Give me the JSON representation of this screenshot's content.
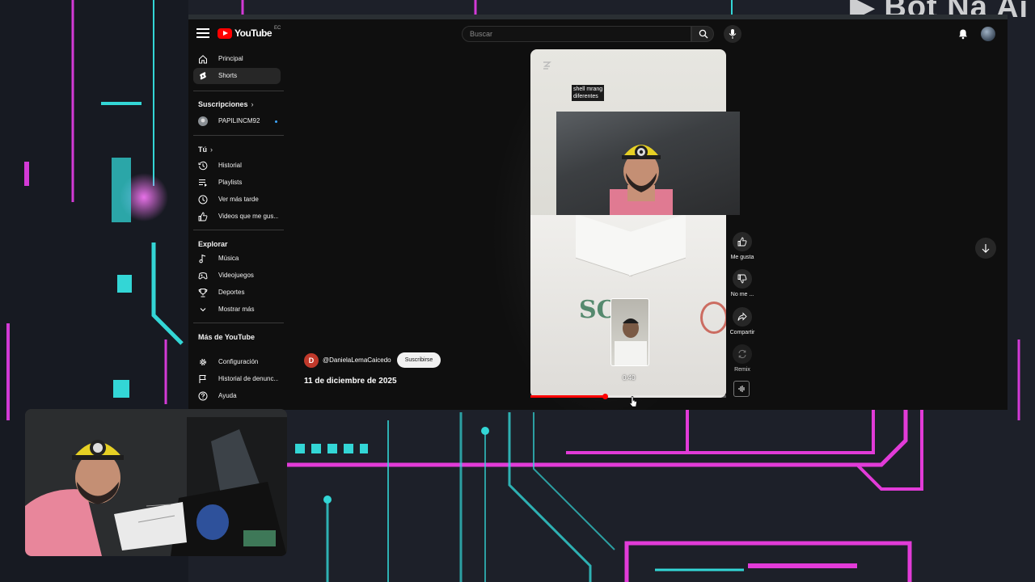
{
  "overlay": {
    "brand_text": "Bot Na Ai"
  },
  "youtube": {
    "logo_text": "YouTube",
    "country_code": "EC",
    "search": {
      "placeholder": "Buscar"
    },
    "sidebar": {
      "main": [
        {
          "label": "Principal",
          "icon": "home-icon",
          "active": false
        },
        {
          "label": "Shorts",
          "icon": "shorts-icon",
          "active": true
        }
      ],
      "subscriptions_title": "Suscripciones",
      "subscriptions": [
        {
          "label": "PAPILINCM92",
          "icon": "channel-avatar",
          "new_content": true
        }
      ],
      "you_title": "Tú",
      "you": [
        {
          "label": "Historial",
          "icon": "history-icon"
        },
        {
          "label": "Playlists",
          "icon": "playlist-icon"
        },
        {
          "label": "Ver más tarde",
          "icon": "clock-icon"
        },
        {
          "label": "Videos que me gus...",
          "icon": "like-icon"
        }
      ],
      "explore_title": "Explorar",
      "explore": [
        {
          "label": "Música",
          "icon": "music-icon"
        },
        {
          "label": "Videojuegos",
          "icon": "gamepad-icon"
        },
        {
          "label": "Deportes",
          "icon": "trophy-icon"
        },
        {
          "label": "Mostrar más",
          "icon": "chevron-down-icon"
        }
      ],
      "more_title": "Más de YouTube",
      "more": [
        {
          "label": "Configuración",
          "icon": "gear-icon"
        },
        {
          "label": "Historial de denunc...",
          "icon": "flag-icon"
        },
        {
          "label": "Ayuda",
          "icon": "help-icon"
        }
      ]
    },
    "short": {
      "caption_line1": "shell mrang",
      "caption_line2": "diferentes",
      "time": "0:40",
      "progress_fraction": 0.38,
      "channel_initial": "D",
      "channel_name": "@DanielaLemaCaicedo",
      "subscribe_label": "Suscribirse",
      "date": "11 de diciembre de 2025",
      "actions": [
        {
          "label": "Me gusta",
          "icon": "thumbs-up-icon",
          "enabled": true
        },
        {
          "label": "No me ...",
          "icon": "thumbs-down-icon",
          "enabled": true
        },
        {
          "label": "Compartir",
          "icon": "share-icon",
          "enabled": true
        },
        {
          "label": "Remix",
          "icon": "remix-icon",
          "enabled": false
        }
      ]
    }
  },
  "colors": {
    "accent_red": "#ff0000",
    "neon_magenta": "#e23bd8",
    "neon_cyan": "#33d6d6",
    "yt_bg": "#0f0f0f"
  }
}
